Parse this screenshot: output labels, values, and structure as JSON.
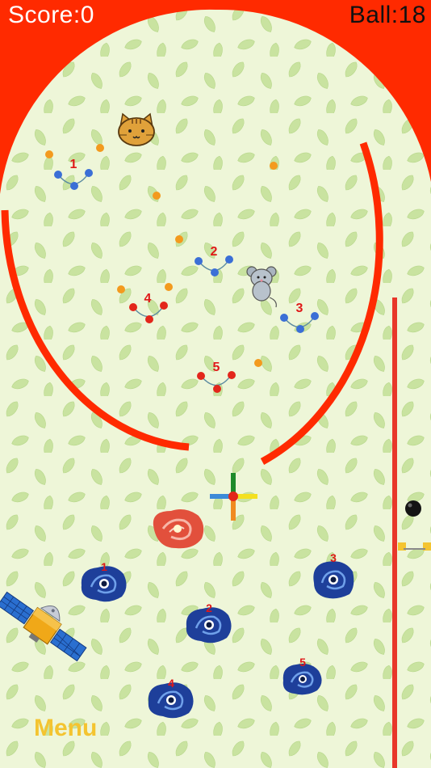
{
  "hud": {
    "score_label": "Score:0",
    "balls_label": "Ball:18"
  },
  "menu_label": "Menu",
  "colors": {
    "wall": "#ff2a00",
    "background": "#eef6d8",
    "leaf": "#c9e3a0",
    "peg_blue": "#3b6fd6",
    "peg_red": "#e3261b",
    "orange_dot": "#f39a1e",
    "number_red": "#e01818",
    "menu_yellow": "#f4c430",
    "vortex_blue": "#1e3f9a",
    "galaxy_red": "#e2503c"
  },
  "cups": [
    {
      "label": "1",
      "peg": "blue"
    },
    {
      "label": "2",
      "peg": "blue"
    },
    {
      "label": "3",
      "peg": "blue"
    },
    {
      "label": "4",
      "peg": "red"
    },
    {
      "label": "5",
      "peg": "red"
    }
  ],
  "holes": [
    {
      "label": "1"
    },
    {
      "label": "2"
    },
    {
      "label": "3"
    },
    {
      "label": "4"
    },
    {
      "label": "5"
    }
  ],
  "icons": {
    "cat": "cat-face-icon",
    "mouse": "mouse-icon",
    "satellite": "satellite-icon",
    "galaxy": "red-galaxy-icon",
    "crosshair": "crosshair-icon"
  }
}
